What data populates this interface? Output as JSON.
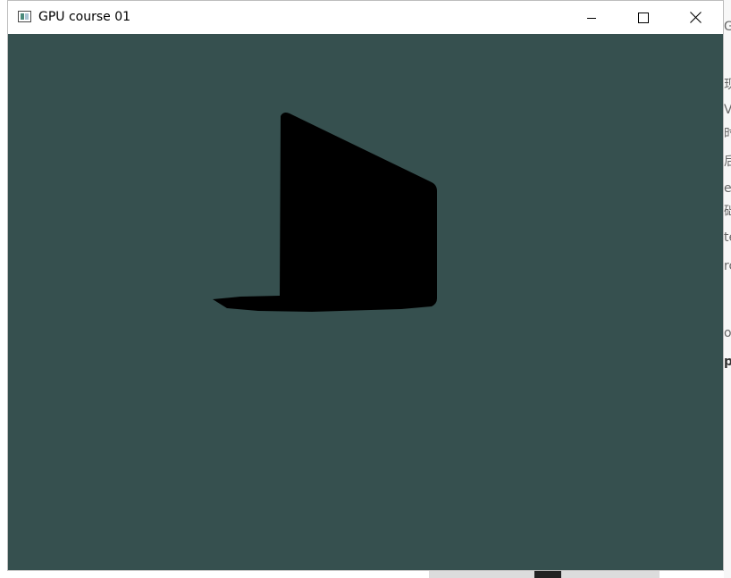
{
  "window": {
    "title": "GPU course 01",
    "clear_color": "#36504f",
    "mesh_color": "#000000"
  },
  "caption_buttons": {
    "minimize": "minimize-icon",
    "maximize": "maximize-icon",
    "close": "close-icon"
  },
  "background": {
    "right_fragments": [
      "GI",
      "现",
      "VA",
      "时",
      "后",
      "er",
      "础",
      "te",
      "rc",
      "ol",
      "p"
    ]
  }
}
